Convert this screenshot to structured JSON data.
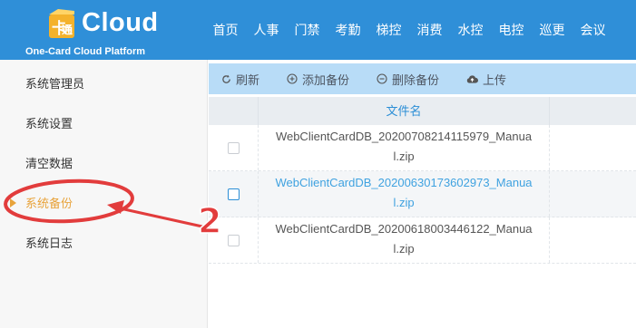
{
  "header": {
    "logo_text": "Cloud",
    "logo_subtitle": "One-Card Cloud Platform",
    "nav": [
      "首页",
      "人事",
      "门禁",
      "考勤",
      "梯控",
      "消费",
      "水控",
      "电控",
      "巡更",
      "会议"
    ]
  },
  "sidebar": {
    "items": [
      {
        "label": "系统管理员"
      },
      {
        "label": "系统设置"
      },
      {
        "label": "清空数据"
      },
      {
        "label": "系统备份",
        "active": true
      },
      {
        "label": "系统日志"
      }
    ]
  },
  "toolbar": {
    "refresh": "刷新",
    "add_backup": "添加备份",
    "delete_backup": "删除备份",
    "upload": "上传"
  },
  "table": {
    "header": "文件名",
    "rows": [
      {
        "name": "WebClientCardDB_20200708214115979_Manual.zip",
        "selected": false
      },
      {
        "name": "WebClientCardDB_20200630173602973_Manual.zip",
        "selected": true
      },
      {
        "name": "WebClientCardDB_20200618003446122_Manual.zip",
        "selected": false
      }
    ]
  },
  "annotation": {
    "step_number": "2",
    "color": "#e23c3c"
  },
  "colors": {
    "header_bg": "#2f8fd8",
    "toolbar_bg": "#b8dcf7",
    "active_item": "#e8a33b",
    "link_blue": "#2b8ed6"
  }
}
